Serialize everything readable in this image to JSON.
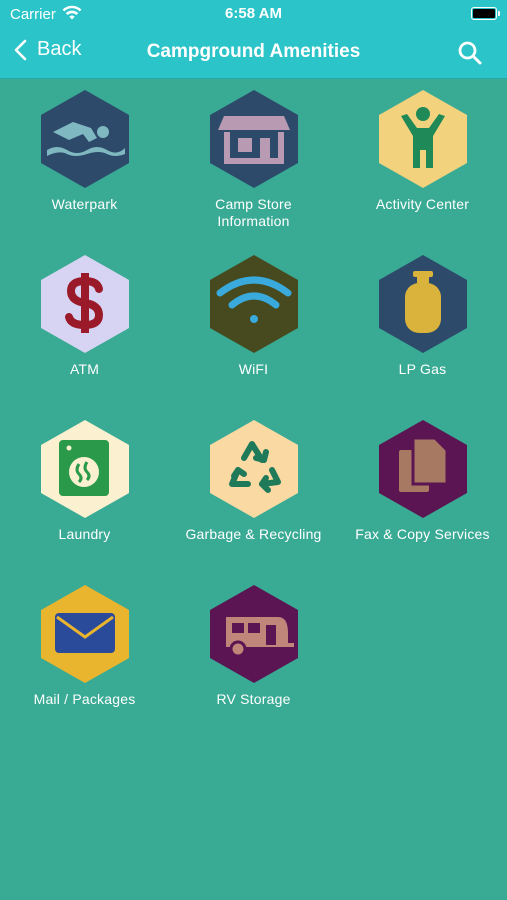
{
  "status_bar": {
    "carrier": "Carrier",
    "time": "6:58 AM"
  },
  "nav": {
    "back_label": "Back",
    "title": "Campground Amenities"
  },
  "amenities": [
    {
      "label": "Waterpark",
      "icon": "swimmer-icon",
      "bg": "#2d4a6b"
    },
    {
      "label": "Camp Store\nInformation",
      "icon": "store-icon",
      "bg": "#2d4a6b"
    },
    {
      "label": "Activity Center",
      "icon": "person-icon",
      "bg": "#f3d27e"
    },
    {
      "label": "ATM",
      "icon": "dollar-icon",
      "bg": "#d6d4f2"
    },
    {
      "label": "WiFI",
      "icon": "wifi-icon",
      "bg": "#464a1e"
    },
    {
      "label": "LP Gas",
      "icon": "gas-tank-icon",
      "bg": "#2d4a6b"
    },
    {
      "label": "Laundry",
      "icon": "washing-machine-icon",
      "bg": "#fbf0cf"
    },
    {
      "label": "Garbage & Recycling",
      "icon": "recycle-icon",
      "bg": "#fbd9a3"
    },
    {
      "label": "Fax & Copy Services",
      "icon": "copy-icon",
      "bg": "#5a1552"
    },
    {
      "label": "Mail / Packages",
      "icon": "envelope-icon",
      "bg": "#e9b42e"
    },
    {
      "label": "RV Storage",
      "icon": "rv-icon",
      "bg": "#5a1552"
    }
  ]
}
